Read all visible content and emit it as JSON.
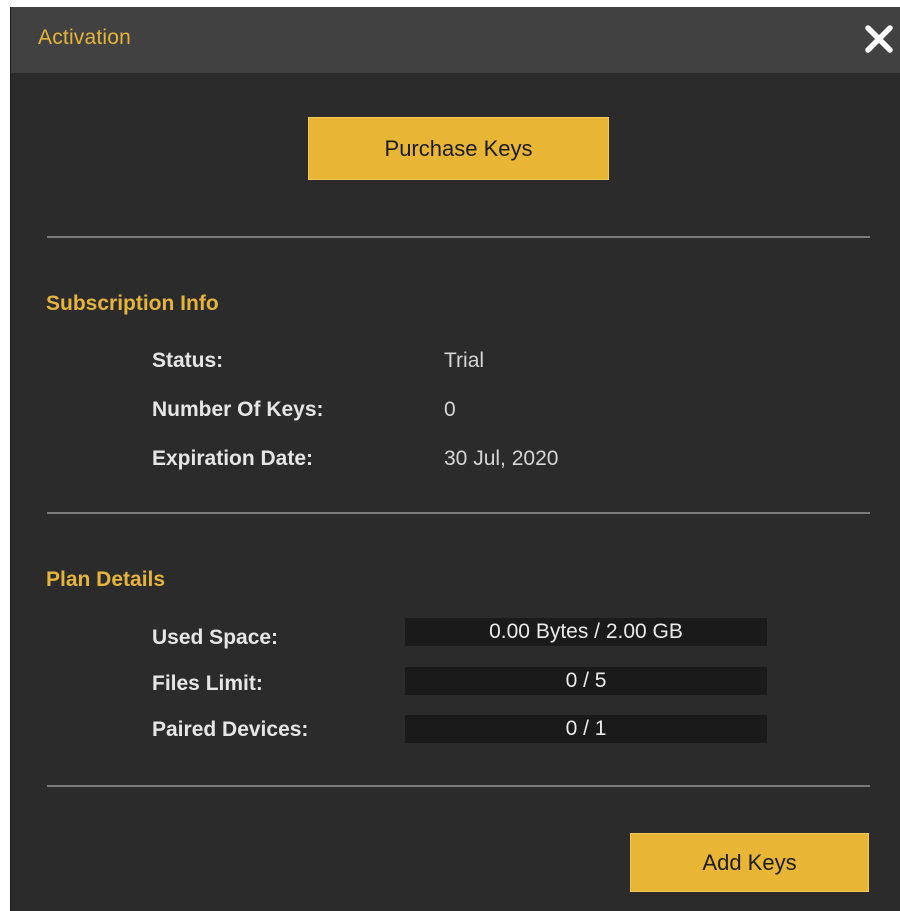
{
  "window": {
    "title": "Activation",
    "close_icon": "close-icon"
  },
  "purchase_button_label": "Purchase Keys",
  "subscription": {
    "heading": "Subscription Info",
    "rows": [
      {
        "label": "Status:",
        "value": "Trial"
      },
      {
        "label": "Number Of Keys:",
        "value": "0"
      },
      {
        "label": "Expiration Date:",
        "value": "30 Jul, 2020"
      }
    ]
  },
  "plan": {
    "heading": "Plan Details",
    "rows": [
      {
        "label": "Used Space:",
        "value": "0.00 Bytes / 2.00 GB",
        "progress": 0
      },
      {
        "label": "Files Limit:",
        "value": "0 / 5",
        "progress": 0
      },
      {
        "label": "Paired Devices:",
        "value": "0 / 1",
        "progress": 0
      }
    ]
  },
  "add_keys_button_label": "Add Keys",
  "colors": {
    "accent": "#e8b535",
    "heading_text": "#e6b43a",
    "window_bg": "#2b2b2b",
    "titlebar_bg": "#414141",
    "meter_bg": "#1a1a1a"
  }
}
